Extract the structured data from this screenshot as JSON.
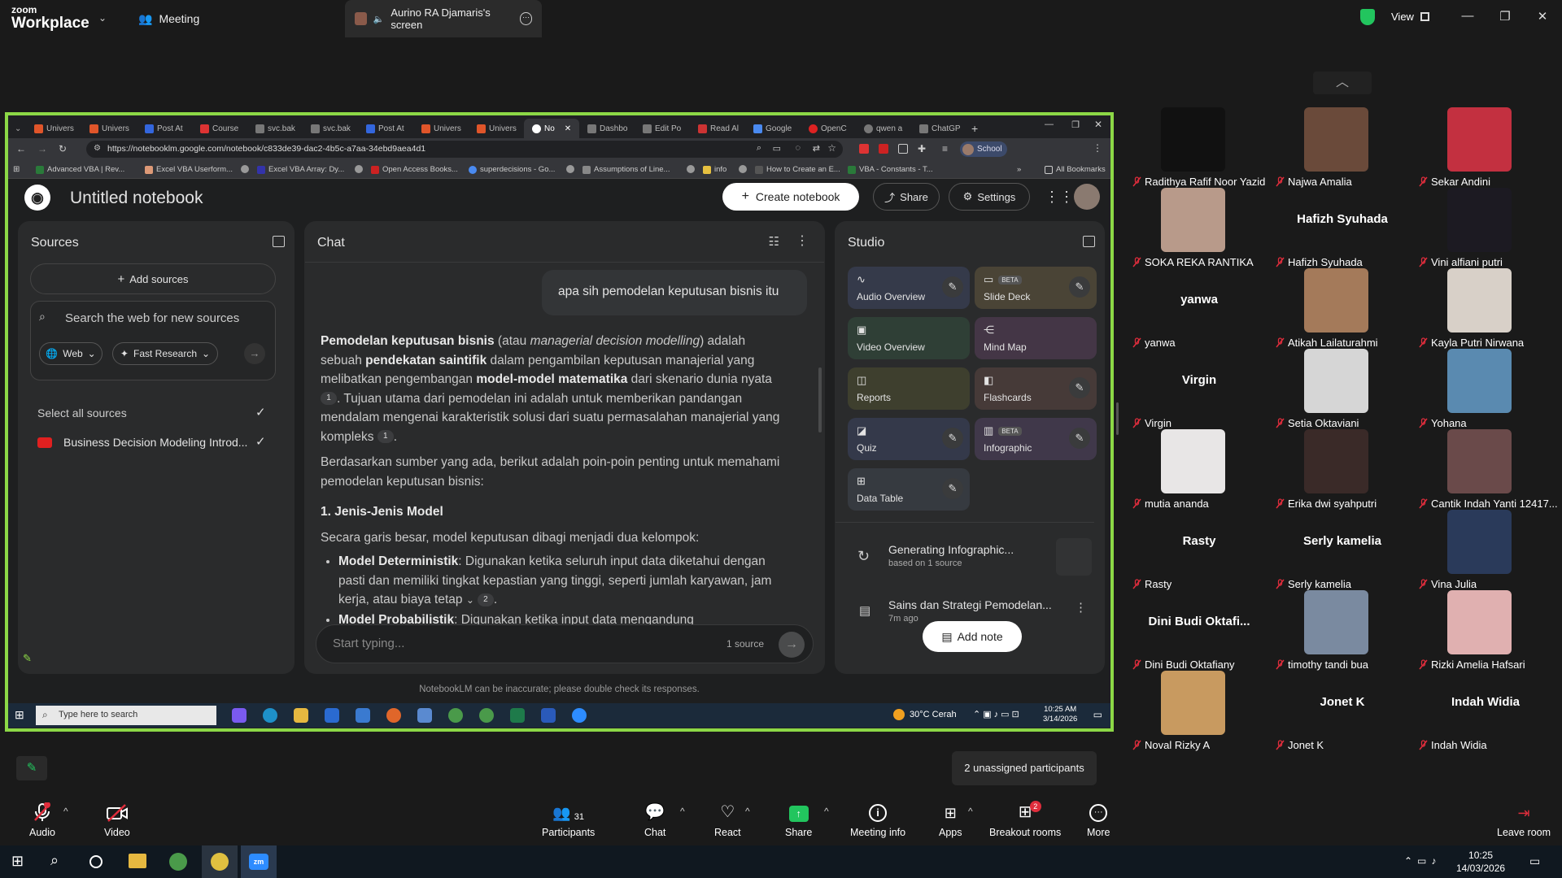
{
  "zoom": {
    "brand_small": "zoom",
    "brand_big": "Workplace",
    "meeting_tab": "Meeting",
    "share_tab": "Aurino RA Djamaris's screen",
    "view_label": "View",
    "unassigned": "2 unassigned participants",
    "toolbar": {
      "audio": "Audio",
      "video": "Video",
      "participants": "Participants",
      "participants_count": "31",
      "chat": "Chat",
      "react": "React",
      "share": "Share",
      "meeting_info": "Meeting info",
      "apps": "Apps",
      "breakout": "Breakout rooms",
      "breakout_badge": "2",
      "more": "More",
      "leave": "Leave room"
    },
    "win_time": "10:25",
    "win_date": "14/03/2026"
  },
  "browser": {
    "tabs": [
      "Univers",
      "Univers",
      "Post At",
      "Course",
      "svc.bak",
      "svc.bak",
      "Post At",
      "Univers",
      "Univers",
      "No",
      "Dashbo",
      "Edit Po",
      "Read Al",
      "Google",
      "OpenC",
      "qwen a",
      "ChatGP"
    ],
    "url": "https://notebooklm.google.com/notebook/c833de39-dac2-4b5c-a7aa-34ebd9aea4d1",
    "profile": "School",
    "bookmarks": [
      "Advanced VBA | Rev...",
      "Excel VBA Userform...",
      "Excel VBA Array: Dy...",
      "",
      "Open Access Books...",
      "superdecisions - Go...",
      "Assumptions of Line...",
      "info",
      "How to Create an E...",
      "VBA - Constants - T..."
    ],
    "all_bookmarks": "All Bookmarks"
  },
  "notebook": {
    "title": "Untitled notebook",
    "create": "Create notebook",
    "share": "Share",
    "settings": "Settings",
    "sources": {
      "title": "Sources",
      "add": "Add sources",
      "search_placeholder": "Search the web for new sources",
      "web": "Web",
      "fast": "Fast Research",
      "select_all": "Select all sources",
      "item": "Business Decision Modeling Introd..."
    },
    "chat": {
      "title": "Chat",
      "user_msg": "apa sih  pemodelan keputusan bisnis itu",
      "p1_b1": "Pemodelan keputusan bisnis",
      "p1_t1": " (atau ",
      "p1_i": "managerial decision modelling",
      "p1_t2": ") adalah sebuah ",
      "p1_b2": "pendekatan saintifik",
      "p1_t3": " dalam pengambilan keputusan manajerial yang melibatkan pengembangan ",
      "p1_b3": "model-model matematika",
      "p1_t4": " dari skenario dunia nyata ",
      "cite1": "1",
      "p1_t5": ". Tujuan utama dari pemodelan ini adalah untuk memberikan pandangan mendalam mengenai karakteristik solusi dari suatu permasalahan manajerial yang kompleks ",
      "cite2": "1",
      "p1_t6": ".",
      "p2": "Berdasarkan sumber yang ada, berikut adalah poin-poin penting untuk memahami pemodelan keputusan bisnis:",
      "h1": "1. Jenis-Jenis Model",
      "p3": "Secara garis besar, model keputusan dibagi menjadi dua kelompok:",
      "li1_b": "Model Deterministik",
      "li1_t": ": Digunakan ketika seluruh input data diketahui dengan pasti dan memiliki tingkat kepastian yang tinggi, seperti jumlah karyawan, jam kerja, atau biaya tetap ",
      "cite3": "2",
      "li2_b": "Model Probabilistik",
      "li2_t": ": Digunakan ketika input data mengandung",
      "input_placeholder": "Start typing...",
      "source_count": "1 source"
    },
    "studio": {
      "title": "Studio",
      "audio": "Audio Overview",
      "slide": "Slide Deck",
      "beta": "BETA",
      "video": "Video Overview",
      "mindmap": "Mind Map",
      "reports": "Reports",
      "flashcards": "Flashcards",
      "quiz": "Quiz",
      "infographic": "Infographic",
      "datatable": "Data Table",
      "gen_title": "Generating Infographic...",
      "gen_sub": "based on 1 source",
      "note_title": "Sains dan Strategi Pemodelan...",
      "note_sub": "7m ago",
      "add_note": "Add note"
    },
    "disclaimer": "NotebookLM can be inaccurate; please double check its responses."
  },
  "inner_taskbar": {
    "search": "Type here to search",
    "weather": "30°C  Cerah",
    "time": "10:25 AM",
    "date": "3/14/2026"
  },
  "participants": [
    {
      "name": "Radithya Rafif Noor Yazid",
      "big": "",
      "pic": "#111111"
    },
    {
      "name": "Najwa Amalia",
      "big": "",
      "pic": "#6a4a3a"
    },
    {
      "name": "Sekar Andini",
      "big": "",
      "pic": "#c33040"
    },
    {
      "name": "SOKA REKA RANTIKA",
      "big": "",
      "pic": "#b89a8a"
    },
    {
      "name": "Hafizh Syuhada",
      "big": "Hafizh Syuhada",
      "pic": ""
    },
    {
      "name": "Vini alfiani putri",
      "big": "",
      "pic": "#1c1a22"
    },
    {
      "name": "yanwa",
      "big": "yanwa",
      "pic": ""
    },
    {
      "name": "Atikah Lailaturahmi",
      "big": "",
      "pic": "#a47a5a"
    },
    {
      "name": "Kayla Putri Nirwana",
      "big": "",
      "pic": "#d8d0c8"
    },
    {
      "name": "Virgin",
      "big": "Virgin",
      "pic": ""
    },
    {
      "name": "Setia Oktaviani",
      "big": "",
      "pic": "#d6d6d6"
    },
    {
      "name": "Yohana",
      "big": "",
      "pic": "#5a8ab0"
    },
    {
      "name": "mutia ananda",
      "big": "",
      "pic": "#e8e6e6"
    },
    {
      "name": "Erika dwi syahputri",
      "big": "",
      "pic": "#3a2a28"
    },
    {
      "name": "Cantik Indah Yanti 12417...",
      "big": "",
      "pic": "#6a4a4a"
    },
    {
      "name": "Rasty",
      "big": "Rasty",
      "pic": ""
    },
    {
      "name": "Serly kamelia",
      "big": "Serly kamelia",
      "pic": ""
    },
    {
      "name": "Vina Julia",
      "big": "",
      "pic": "#2a3a5a"
    },
    {
      "name": "Dini Budi Oktafiany",
      "big": "Dini Budi Oktafi...",
      "pic": ""
    },
    {
      "name": "timothy tandi bua",
      "big": "",
      "pic": "#7a8aa0"
    },
    {
      "name": "Rizki Amelia Hafsari",
      "big": "",
      "pic": "#e0b0b0"
    },
    {
      "name": "Noval Rizky A",
      "big": "",
      "pic": "#c89a60"
    },
    {
      "name": "Jonet K",
      "big": "Jonet K",
      "pic": ""
    },
    {
      "name": "Indah Widia",
      "big": "Indah Widia",
      "pic": ""
    }
  ],
  "colors": {
    "share_border": "#8cd846",
    "mic_muted": "#e02d3c",
    "share_green": "#22c55e"
  }
}
